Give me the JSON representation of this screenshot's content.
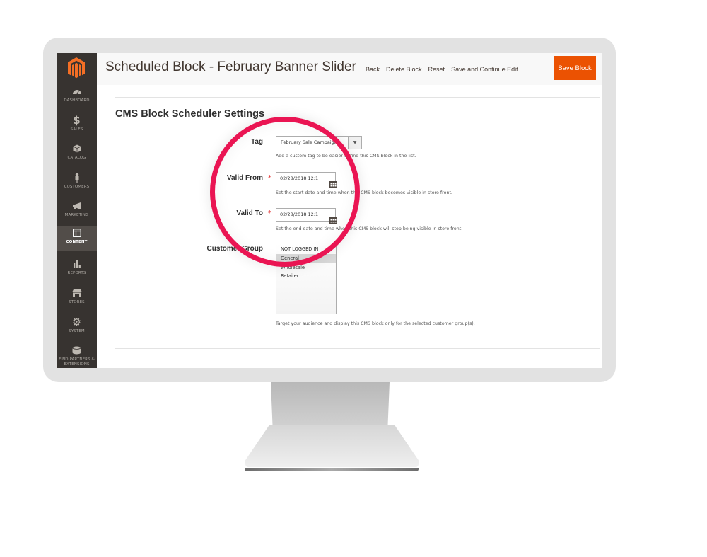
{
  "app": {
    "brand_color": "#eb5202",
    "highlight_ring_color": "#ea1553",
    "logo": "magento-logo-icon"
  },
  "sidebar": {
    "items": [
      {
        "label": "DASHBOARD",
        "icon": "dashboard-gauge-icon"
      },
      {
        "label": "SALES",
        "icon": "dollar-icon"
      },
      {
        "label": "CATALOG",
        "icon": "box-icon"
      },
      {
        "label": "CUSTOMERS",
        "icon": "person-icon"
      },
      {
        "label": "MARKETING",
        "icon": "megaphone-icon"
      },
      {
        "label": "CONTENT",
        "icon": "layout-icon",
        "active": true
      },
      {
        "label": "REPORTS",
        "icon": "bar-chart-icon"
      },
      {
        "label": "STORES",
        "icon": "storefront-icon"
      },
      {
        "label": "SYSTEM",
        "icon": "gear-icon"
      },
      {
        "label": "FIND PARTNERS & EXTENSIONS",
        "icon": "cube-icon"
      }
    ]
  },
  "header": {
    "title": "Scheduled Block - February Banner Slider",
    "actions": {
      "back": "Back",
      "delete": "Delete Block",
      "reset": "Reset",
      "save_continue": "Save and Continue Edit",
      "save": "Save Block"
    }
  },
  "form": {
    "section_title": "CMS Block Scheduler Settings",
    "tag": {
      "label": "Tag",
      "value": "February Sale Campaign",
      "note": "Add a custom tag to be easier to find this CMS block in the list."
    },
    "valid_from": {
      "label": "Valid From",
      "required": "*",
      "value": "02/28/2018 12:1",
      "note": "Set the start date and time when this CMS block becomes visible in store front."
    },
    "valid_to": {
      "label": "Valid To",
      "required": "*",
      "value": "02/28/2018 12:1",
      "note": "Set the end date and time when this CMS block will stop being visible in store front."
    },
    "customer_group": {
      "label": "Customer Group",
      "options": [
        "NOT LOGGED IN",
        "General",
        "Wholesale",
        "Retailer"
      ],
      "selected": "General",
      "note": "Target your audience and display this CMS block only for the selected customer group(s)."
    }
  }
}
